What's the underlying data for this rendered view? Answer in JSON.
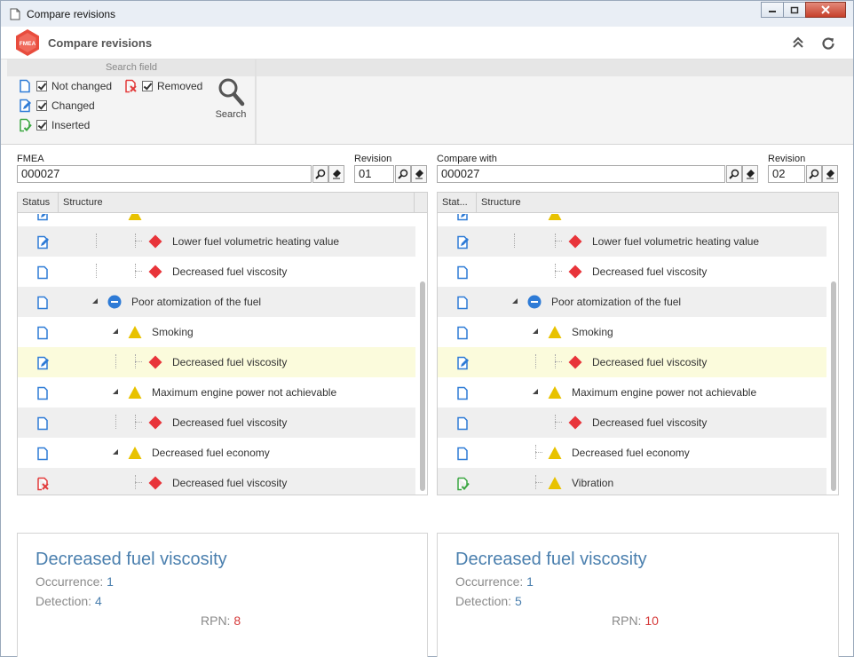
{
  "window": {
    "title": "Compare revisions"
  },
  "app": {
    "title": "Compare revisions",
    "logo_text": "FMEA"
  },
  "ribbon": {
    "group_title": "Search field",
    "options": {
      "not_changed": "Not changed",
      "changed": "Changed",
      "inserted": "Inserted",
      "removed": "Removed"
    },
    "search_label": "Search"
  },
  "left": {
    "fmea_label": "FMEA",
    "fmea_value": "000027",
    "revision_label": "Revision",
    "revision_value": "01",
    "col_status": "Status",
    "col_structure": "Structure",
    "rows": [
      {
        "label": "Lower fuel volumetric heating value",
        "status": "changed",
        "node": "cause"
      },
      {
        "label": "Decreased fuel viscosity",
        "status": "not_changed",
        "node": "cause"
      },
      {
        "label": "Poor atomization of the fuel",
        "status": "not_changed",
        "node": "failure"
      },
      {
        "label": "Smoking",
        "status": "not_changed",
        "node": "effect"
      },
      {
        "label": "Decreased fuel viscosity",
        "status": "changed",
        "node": "cause"
      },
      {
        "label": "Maximum engine power not achievable",
        "status": "not_changed",
        "node": "effect"
      },
      {
        "label": "Decreased fuel viscosity",
        "status": "not_changed",
        "node": "cause"
      },
      {
        "label": "Decreased fuel economy",
        "status": "not_changed",
        "node": "effect"
      },
      {
        "label": "Decreased fuel viscosity",
        "status": "removed",
        "node": "cause"
      }
    ],
    "detail": {
      "title": "Decreased fuel viscosity",
      "occurrence_label": "Occurrence:",
      "occurrence_value": "1",
      "detection_label": "Detection:",
      "detection_value": "4",
      "rpn_label": "RPN:",
      "rpn_value": "8"
    }
  },
  "right": {
    "fmea_label": "Compare with",
    "fmea_value": "000027",
    "revision_label": "Revision",
    "revision_value": "02",
    "col_status": "Stat...",
    "col_structure": "Structure",
    "rows": [
      {
        "label": "Lower fuel volumetric heating value",
        "status": "changed",
        "node": "cause"
      },
      {
        "label": "Decreased fuel viscosity",
        "status": "not_changed",
        "node": "cause"
      },
      {
        "label": "Poor atomization of the fuel",
        "status": "not_changed",
        "node": "failure"
      },
      {
        "label": "Smoking",
        "status": "not_changed",
        "node": "effect"
      },
      {
        "label": "Decreased fuel viscosity",
        "status": "changed",
        "node": "cause"
      },
      {
        "label": "Maximum engine power not achievable",
        "status": "not_changed",
        "node": "effect"
      },
      {
        "label": "Decreased fuel viscosity",
        "status": "not_changed",
        "node": "cause"
      },
      {
        "label": "Decreased fuel economy",
        "status": "not_changed",
        "node": "effect"
      },
      {
        "label": "Vibration",
        "status": "inserted",
        "node": "effect"
      }
    ],
    "detail": {
      "title": "Decreased fuel viscosity",
      "occurrence_label": "Occurrence:",
      "occurrence_value": "1",
      "detection_label": "Detection:",
      "detection_value": "5",
      "rpn_label": "RPN:",
      "rpn_value": "10"
    }
  },
  "colors": {
    "accent_blue": "#4a7fae",
    "status_blue": "#2e7bd6",
    "removed_red": "#e23b3b",
    "inserted_green": "#3aa640",
    "cause_red": "#e8343a",
    "effect_yellow": "#e8c200",
    "highlight_row": "#fbfbdc"
  }
}
